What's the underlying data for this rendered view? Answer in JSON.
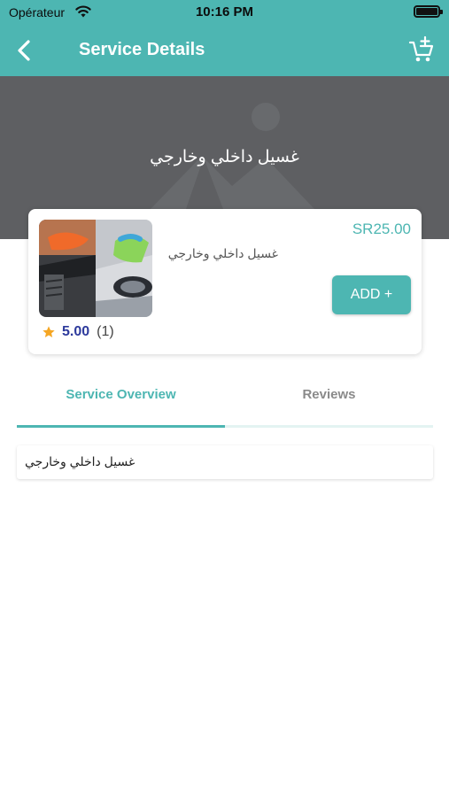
{
  "status_bar": {
    "carrier": "Opérateur",
    "time": "10:16 PM"
  },
  "nav": {
    "title": "Service Details",
    "back_icon": "chevron-left-icon",
    "cart_icon": "cart-add-icon"
  },
  "hero": {
    "title": "غسيل داخلي وخارجي"
  },
  "service_card": {
    "price": "SR25.00",
    "name": "غسيل داخلي وخارجي",
    "add_label": "ADD +",
    "rating_value": "5.00",
    "rating_count": "(1)"
  },
  "tabs": [
    {
      "label": "Service Overview",
      "active": true
    },
    {
      "label": "Reviews",
      "active": false
    }
  ],
  "overview": {
    "text": "غسيل داخلي وخارجي"
  },
  "colors": {
    "accent": "#4db6b2",
    "hero_bg": "#5e5f62",
    "rating": "#2d3a9c",
    "star": "#f5a623"
  }
}
